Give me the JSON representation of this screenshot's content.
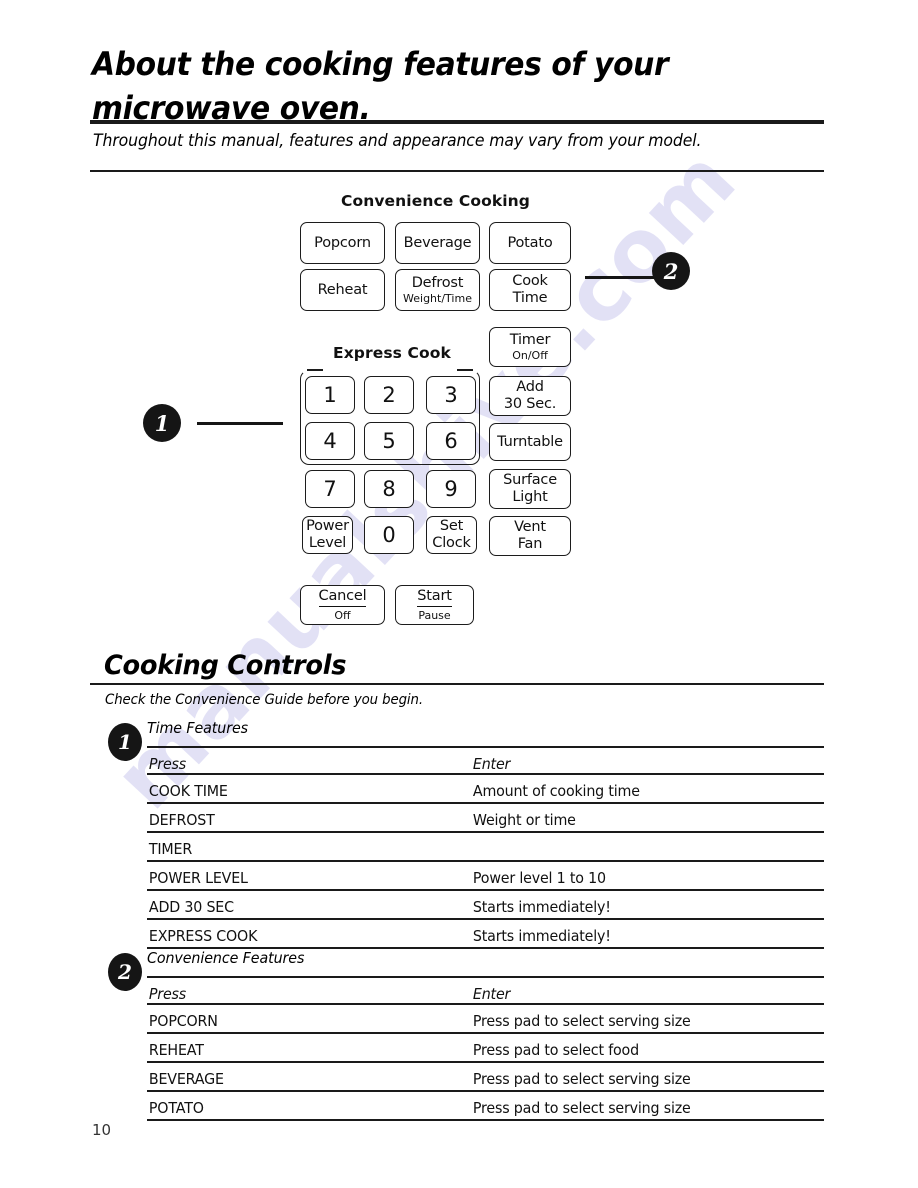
{
  "header": {
    "title_line1": "About the cooking features of your",
    "title_line2": "microwave oven.",
    "subtitle": "Throughout this manual, features and appearance may vary from your model."
  },
  "watermark": {
    "text": "manualshive.com"
  },
  "panel": {
    "convenience_label": "Convenience Cooking",
    "express_label": "Express Cook",
    "convenience_keys": [
      {
        "main": "Popcorn",
        "sub": ""
      },
      {
        "main": "Beverage",
        "sub": ""
      },
      {
        "main": "Potato",
        "sub": ""
      },
      {
        "main": "Reheat",
        "sub": ""
      },
      {
        "main": "Defrost",
        "sub": "Weight/Time"
      },
      {
        "main": "Cook",
        "sub": "Time"
      }
    ],
    "number_keys": [
      {
        "main": "1"
      },
      {
        "main": "2"
      },
      {
        "main": "3"
      },
      {
        "main": "4"
      },
      {
        "main": "5"
      },
      {
        "main": "6"
      },
      {
        "main": "7"
      },
      {
        "main": "8"
      },
      {
        "main": "9"
      }
    ],
    "bottom_keys": [
      {
        "main": "Power",
        "sub": "Level"
      },
      {
        "main": "0",
        "sub": ""
      },
      {
        "main": "Set",
        "sub": "Clock"
      }
    ],
    "right_keys": [
      {
        "main": "Timer",
        "sub": "On/Off"
      },
      {
        "main": "Add",
        "sub": "30 Sec."
      },
      {
        "main": "Turntable",
        "sub": ""
      },
      {
        "main": "Surface",
        "sub": "Light"
      },
      {
        "main": "Vent",
        "sub": "Fan"
      }
    ],
    "action_keys": [
      {
        "main": "Cancel",
        "sub": "Off"
      },
      {
        "main": "Start",
        "sub": "Pause"
      }
    ],
    "callout_1": "1",
    "callout_2": "2"
  },
  "section": {
    "title": "Cooking Controls",
    "note": "Check the Convenience Guide before you begin."
  },
  "time_features": {
    "badge": "1",
    "caption": "Time Features",
    "columns": [
      "Press",
      "Enter"
    ],
    "rows": [
      [
        "COOK TIME",
        "Amount of cooking time"
      ],
      [
        "DEFROST",
        "Weight or time"
      ],
      [
        "TIMER",
        ""
      ],
      [
        "POWER LEVEL",
        "Power level 1 to 10"
      ],
      [
        "ADD 30 SEC",
        "Starts immediately!"
      ],
      [
        "EXPRESS COOK",
        "Starts immediately!"
      ]
    ]
  },
  "convenience_features": {
    "badge": "2",
    "caption": "Convenience Features",
    "columns": [
      "Press",
      "Enter"
    ],
    "rows": [
      [
        "POPCORN",
        "Press pad to select serving size"
      ],
      [
        "REHEAT",
        "Press pad to select food"
      ],
      [
        "BEVERAGE",
        "Press pad to select serving size"
      ],
      [
        "POTATO",
        "Press pad to select serving size"
      ]
    ]
  },
  "footer": {
    "page_number": "10"
  }
}
